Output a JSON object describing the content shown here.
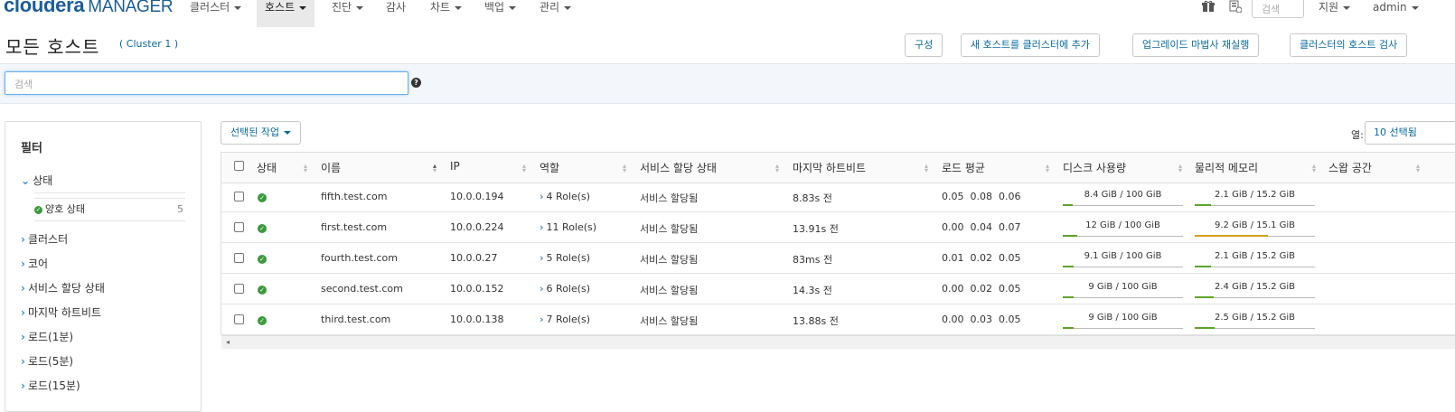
{
  "nav": {
    "logo": "cloudera",
    "logo_suffix": "MANAGER",
    "items": [
      "클러스터",
      "호스트",
      "진단",
      "감사",
      "차트",
      "백업",
      "관리"
    ],
    "search_placeholder": "검색",
    "support": "지원",
    "user": "admin"
  },
  "header": {
    "title": "모든 호스트",
    "cluster": "( Cluster 1 )",
    "buttons": [
      "구성",
      "새 호스트를 클러스터에 추가",
      "업그레이드 마법사 재실행",
      "클러스터의 호스트 검사"
    ]
  },
  "search": {
    "placeholder": "검색"
  },
  "filters": {
    "title": "필터",
    "status_group": "상태",
    "good_status": "양호 상태",
    "good_count": "5",
    "groups": [
      "클러스터",
      "코어",
      "서비스 할당 상태",
      "마지막 하트비트",
      "로드(1분)",
      "로드(5분)",
      "로드(15분)"
    ]
  },
  "toolbar": {
    "selected_actions": "선택된 작업",
    "columns_label": "열:",
    "columns_value": "10 선택됨"
  },
  "table": {
    "headers": [
      "상태",
      "이름",
      "IP",
      "역할",
      "서비스 할당 상태",
      "마지막 하트비트",
      "로드 평균",
      "디스크 사용량",
      "물리적 메모리",
      "스왑 공간"
    ],
    "rows": [
      {
        "name": "fifth.test.com",
        "ip": "10.0.0.194",
        "roles": "4 Role(s)",
        "assign": "서비스 할당됨",
        "heartbeat": "8.83s 전",
        "load": "0.05  0.08  0.06",
        "disk": "8.4 GiB / 100 GiB",
        "disk_frac": 0.084,
        "mem": "2.1 GiB / 15.2 GiB",
        "mem_frac": 0.138,
        "mem_color": "#5da428"
      },
      {
        "name": "first.test.com",
        "ip": "10.0.0.224",
        "roles": "11 Role(s)",
        "assign": "서비스 할당됨",
        "heartbeat": "13.91s 전",
        "load": "0.00  0.04  0.07",
        "disk": "12 GiB / 100 GiB",
        "disk_frac": 0.12,
        "mem": "9.2 GiB / 15.1 GiB",
        "mem_frac": 0.609,
        "mem_color": "#d4a017"
      },
      {
        "name": "fourth.test.com",
        "ip": "10.0.0.27",
        "roles": "5 Role(s)",
        "assign": "서비스 할당됨",
        "heartbeat": "83ms 전",
        "load": "0.01  0.02  0.05",
        "disk": "9.1 GiB / 100 GiB",
        "disk_frac": 0.091,
        "mem": "2.1 GiB / 15.2 GiB",
        "mem_frac": 0.138,
        "mem_color": "#5da428"
      },
      {
        "name": "second.test.com",
        "ip": "10.0.0.152",
        "roles": "6 Role(s)",
        "assign": "서비스 할당됨",
        "heartbeat": "14.3s 전",
        "load": "0.00  0.02  0.05",
        "disk": "9 GiB / 100 GiB",
        "disk_frac": 0.09,
        "mem": "2.4 GiB / 15.2 GiB",
        "mem_frac": 0.158,
        "mem_color": "#5da428"
      },
      {
        "name": "third.test.com",
        "ip": "10.0.0.138",
        "roles": "7 Role(s)",
        "assign": "서비스 할당됨",
        "heartbeat": "13.88s 전",
        "load": "0.00  0.03  0.05",
        "disk": "9 GiB / 100 GiB",
        "disk_frac": 0.09,
        "mem": "2.5 GiB / 15.2 GiB",
        "mem_frac": 0.164,
        "mem_color": "#5da428"
      }
    ]
  }
}
